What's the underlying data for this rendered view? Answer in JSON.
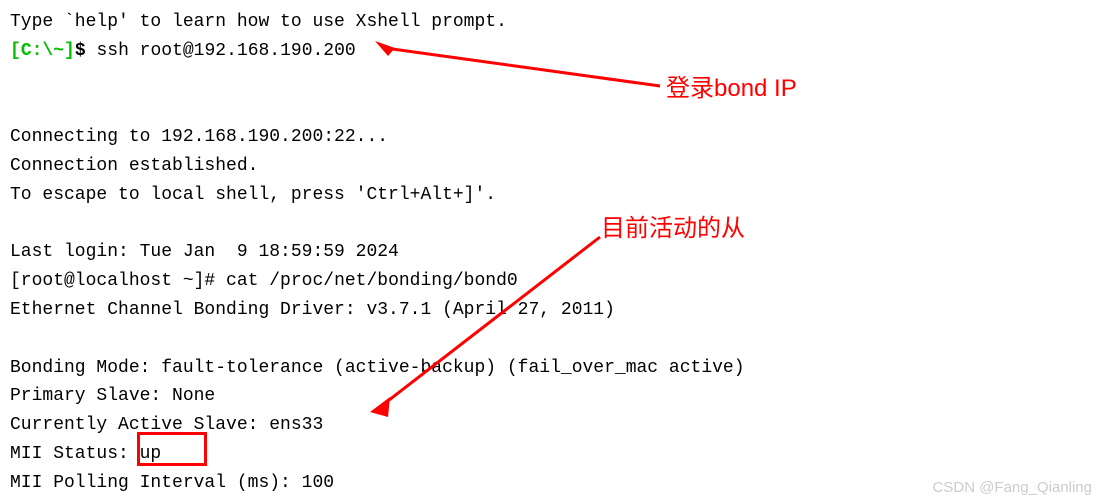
{
  "terminal": {
    "help_line": "Type `help' to learn how to use Xshell prompt.",
    "prompt_bracket_open": "[",
    "prompt_path": "C:\\~",
    "prompt_bracket_close": "]",
    "prompt_dollar": "$",
    "ssh_command": "ssh root@192.168.190.200",
    "connecting": "Connecting to 192.168.190.200:22...",
    "established": "Connection established.",
    "escape": "To escape to local shell, press 'Ctrl+Alt+]'.",
    "last_login": "Last login: Tue Jan  9 18:59:59 2024",
    "root_prompt": "[root@localhost ~]# ",
    "cat_command": "cat /proc/net/bonding/bond0",
    "driver": "Ethernet Channel Bonding Driver: v3.7.1 (April 27, 2011)",
    "bonding_mode": "Bonding Mode: fault-tolerance (active-backup) (fail_over_mac active)",
    "primary_slave": "Primary Slave: None",
    "active_slave": "Currently Active Slave: ens33",
    "mii_status": "MII Status: up",
    "mii_polling": "MII Polling Interval (ms): 100"
  },
  "annotations": {
    "login_bond": "登录bond IP",
    "active_slave_note": "目前活动的从"
  },
  "watermark": "CSDN @Fang_Qianling"
}
